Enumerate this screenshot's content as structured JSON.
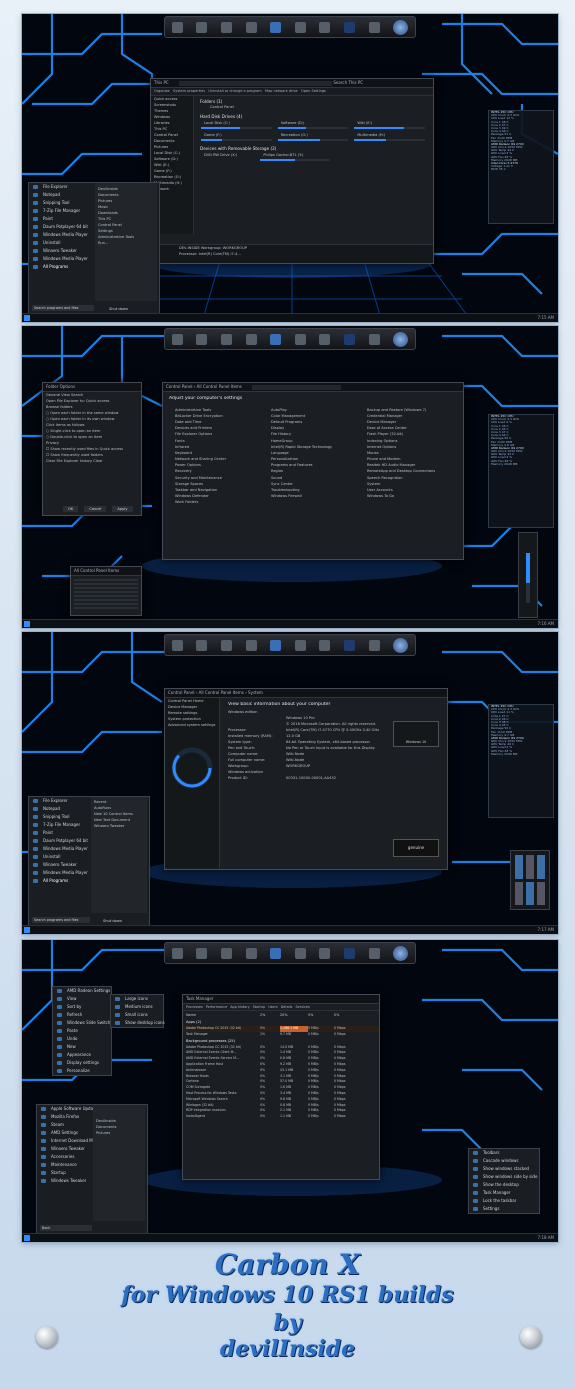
{
  "screens": [
    {
      "explorer": {
        "title": "This PC",
        "search": "Search This PC",
        "toolbar": [
          "Organize",
          "System properties",
          "Uninstall or change a program",
          "Map network drive",
          "Open Settings"
        ],
        "sections": [
          "Folders (1)",
          "Hard Disk Drives (4)",
          "Devices with Removable Storage (2)"
        ],
        "drives": [
          "Local Disk (C:)",
          "Software (D:)",
          "Wiki (E:)",
          "Game (F:)",
          "Recreation (G:)",
          "Multimedia (H:)"
        ],
        "removable": [
          "DVD RW Drive (X:)",
          "Philips Gochor-BTL (Y:)"
        ],
        "folder": "Control Panel",
        "details": {
          "name": "DEV-INSIDE Workgroup: WORKGROUP",
          "memory": "Memory: 11.0 GB",
          "processor": "Processor: Intel(R) Core(TM) i7-4..."
        }
      },
      "start_menu": {
        "items": [
          "File Explorer",
          "Notepad",
          "Snipping Tool",
          "7-Zip File Manager",
          "Paint",
          "Daum Potplayer 64 bit",
          "Windows Media Player",
          "Uninstall",
          "Winaero Tweaker",
          "Windows Media Player"
        ],
        "right": [
          "DevilInside",
          "Documents",
          "Pictures",
          "Music",
          "Downloads",
          "This PC",
          "Control Panel",
          "Settings",
          "Administrative Tools",
          "Run..."
        ],
        "all": "All Programs",
        "search": "Search programs and files",
        "shutdown": "Shut down"
      }
    },
    {
      "control_panel": {
        "title": "All Control Panel Items",
        "heading": "Adjust your computer's settings",
        "items": [
          "Administrative Tools",
          "AutoPlay",
          "Backup and Restore (Windows 7)",
          "BitLocker Drive Encryption",
          "Color Management",
          "Credential Manager",
          "Date and Time",
          "Default Programs",
          "Device Manager",
          "Devices and Printers",
          "Display",
          "Ease of Access Center",
          "File Explorer Options",
          "File History",
          "Flash Player (32-bit)",
          "Fonts",
          "HomeGroup",
          "Indexing Options",
          "Infrared",
          "Intel(R) Rapid Storage Technology",
          "Internet Options",
          "Keyboard",
          "Language",
          "Mouse",
          "Network and Sharing Center",
          "Personalization",
          "Phone and Modem",
          "Power Options",
          "Programs and Features",
          "Realtek HD Audio Manager",
          "Recovery",
          "Region",
          "RemoteApp and Desktop Connections",
          "Security and Maintenance",
          "Sound",
          "Speech Recognition",
          "Storage Spaces",
          "Sync Center",
          "System",
          "Taskbar and Navigation",
          "Troubleshooting",
          "User Accounts",
          "Windows Defender",
          "Windows Firewall",
          "Windows To Go",
          "Work Folders"
        ],
        "folder_options": "Folder Options"
      }
    },
    {
      "system": {
        "title": "System",
        "heading": "View basic information about your computer",
        "rows": [
          [
            "Windows edition",
            ""
          ],
          [
            "",
            "Windows 10 Pro"
          ],
          [
            "",
            "© 2016 Microsoft Corporation. All rights reserved."
          ],
          [
            "Processor:",
            "Intel(R) Core(TM) i7-4770 CPU @ 3.40GHz   3.40 GHz"
          ],
          [
            "Installed memory (RAM):",
            "12.0 GB"
          ],
          [
            "System type:",
            "64-bit Operating System, x64-based processor"
          ],
          [
            "Pen and Touch:",
            "No Pen or Touch Input is available for this Display"
          ],
          [
            "Computer name:",
            "Wiki-Node"
          ],
          [
            "Full computer name:",
            "Wiki-Node"
          ],
          [
            "Workgroup:",
            "WORKGROUP"
          ],
          [
            "Windows activation",
            ""
          ],
          [
            "Product ID:",
            "00331-10000-00001-AA432"
          ]
        ],
        "side": [
          "Control Panel Home",
          "Device Manager",
          "Remote settings",
          "System protection",
          "Advanced system settings"
        ],
        "logo": "Windows 10",
        "genuine": "genuine",
        "change": "Change settings",
        "change_key": "Change product key"
      }
    },
    {
      "taskmgr": {
        "tabs": [
          "Processes",
          "Performance",
          "App history",
          "Startup",
          "Users",
          "Details",
          "Services"
        ],
        "headers": [
          "Name",
          "CPU",
          "Memory",
          "Disk",
          "Network"
        ],
        "pct": [
          "2%",
          "20%",
          "0%",
          "0%"
        ],
        "group1": "Apps (2)",
        "group2": "Background processes (25)",
        "rows": [
          [
            "Adobe Photoshop CC 2015 (32 bit)",
            "0%",
            "1,186.1 MB",
            "0 MB/s",
            "0 Mbps"
          ],
          [
            "Task Manager",
            "1%",
            "9.7 MB",
            "0 MB/s",
            "0 Mbps"
          ],
          [
            "Adobe Photoshop CC 2015 (32 bit)",
            "0%",
            "14.0 MB",
            "0 MB/s",
            "0 Mbps"
          ],
          [
            "AMD External Events Client M...",
            "0%",
            "1.4 MB",
            "0 MB/s",
            "0 Mbps"
          ],
          [
            "AMD External Events Service M...",
            "0%",
            "0.8 MB",
            "0 MB/s",
            "0 Mbps"
          ],
          [
            "Application Frame Host",
            "0%",
            "9.2 MB",
            "0 MB/s",
            "0 Mbps"
          ],
          [
            "Antimalware",
            "0%",
            "43.1 MB",
            "0 MB/s",
            "0 Mbps"
          ],
          [
            "Browser Hosts",
            "0%",
            "3.1 MB",
            "0 MB/s",
            "0 Mbps"
          ],
          [
            "Cortana",
            "0%",
            "57.0 MB",
            "0 MB/s",
            "0 Mbps"
          ],
          [
            "COM Surrogate",
            "0%",
            "1.6 MB",
            "0 MB/s",
            "0 Mbps"
          ],
          [
            "Host Process for Windows Tasks",
            "0%",
            "3.4 MB",
            "0 MB/s",
            "0 Mbps"
          ],
          [
            "Microsoft Windows Search",
            "0%",
            "9.6 MB",
            "0 MB/s",
            "0 Mbps"
          ],
          [
            "Winlogon (32 bit)",
            "0%",
            "0.8 MB",
            "0 MB/s",
            "0 Mbps"
          ],
          [
            "RDP integration modules",
            "0%",
            "2.1 MB",
            "0 MB/s",
            "0 Mbps"
          ],
          [
            "InstallAgent",
            "0%",
            "1.1 MB",
            "0 MB/s",
            "0 Mbps"
          ]
        ]
      },
      "context": [
        "AMD Radeon Settings",
        "View",
        "Sort by",
        "Refresh",
        "Windows Slide Switcher",
        "Paste",
        "Undo",
        "New",
        "Appearance",
        "Display settings",
        "Personalize"
      ],
      "view_sub": [
        "Large icons",
        "Medium icons",
        "Small icons",
        "Show desktop icons"
      ],
      "tray_menu": [
        "Toolbars",
        "Cascade windows",
        "Show windows stacked",
        "Show windows side by side",
        "Show the desktop",
        "Task Manager",
        "Lock the taskbar",
        "Settings"
      ]
    }
  ],
  "credits": {
    "line1": "Carbon X",
    "line2": "for Windows 10 RS1 builds",
    "line3": "by",
    "line4": "devilInside"
  }
}
